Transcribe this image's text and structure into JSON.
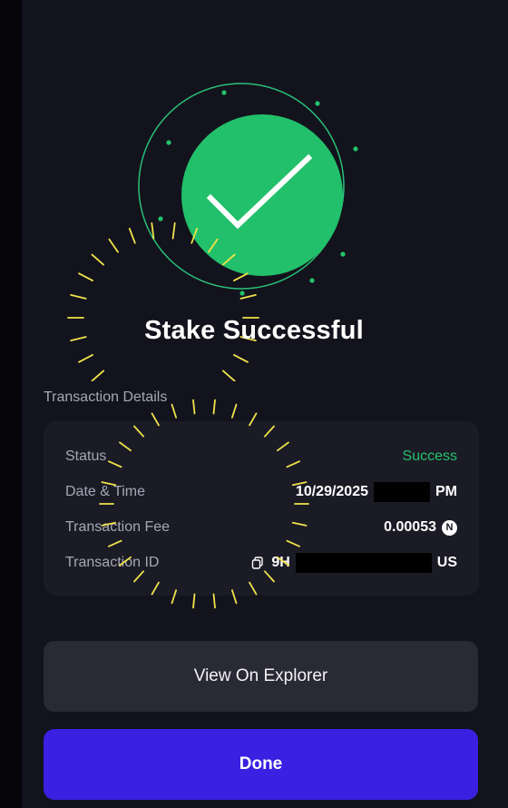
{
  "title": "Stake Successful",
  "details": {
    "section_label": "Transaction Details",
    "status": {
      "label": "Status",
      "value": "Success"
    },
    "datetime": {
      "label": "Date & Time",
      "value_prefix": "10/29/2025",
      "value_suffix": "PM"
    },
    "fee": {
      "label": "Transaction Fee",
      "value": "0.00053",
      "token_icon_glyph": "N"
    },
    "txid": {
      "label": "Transaction ID",
      "value_prefix": "9H",
      "value_suffix": "US"
    }
  },
  "buttons": {
    "explorer_label": "View On Explorer",
    "done_label": "Done"
  },
  "colors": {
    "success_green": "#24c26a",
    "primary_purple": "#3a20e0",
    "spark_yellow": "#f1e34a"
  },
  "icons": [
    "check-icon",
    "copy-icon",
    "token-icon"
  ]
}
